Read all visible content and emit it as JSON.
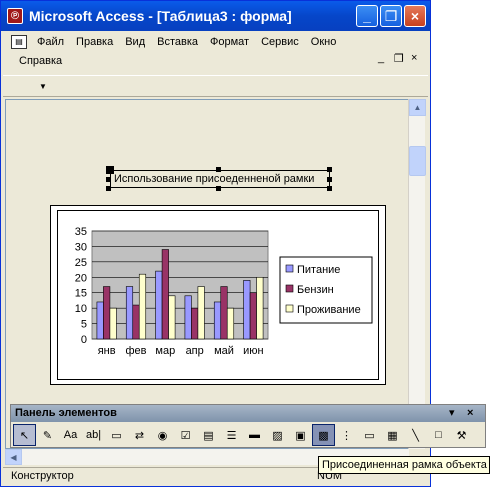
{
  "window": {
    "title": "Microsoft Access - [Таблица3 : форма]",
    "app_icon_glyph": "℗",
    "minimize_glyph": "_",
    "restore_glyph": "❐",
    "close_glyph": "×"
  },
  "menubar": {
    "row1": [
      "Файл",
      "Правка",
      "Вид",
      "Вставка",
      "Формат",
      "Сервис",
      "Окно"
    ],
    "row2": [
      "Справка"
    ],
    "mdi_min": "_",
    "mdi_restore": "❐",
    "mdi_close": "×"
  },
  "form": {
    "label_text": "Использование присоеденненой рамки"
  },
  "chart_data": {
    "type": "bar",
    "categories": [
      "янв",
      "фев",
      "мар",
      "апр",
      "май",
      "июн"
    ],
    "series": [
      {
        "name": "Питание",
        "values": [
          12,
          17,
          22,
          14,
          12,
          19
        ],
        "color": "#9999ff"
      },
      {
        "name": "Бензин",
        "values": [
          17,
          11,
          29,
          10,
          17,
          15
        ],
        "color": "#993366"
      },
      {
        "name": "Проживание",
        "values": [
          10,
          21,
          14,
          17,
          10,
          20
        ],
        "color": "#ffffcc"
      }
    ],
    "yticks": [
      "0",
      "5",
      "10",
      "15",
      "20",
      "25",
      "30",
      "35"
    ],
    "ylim": [
      0,
      35
    ],
    "plot_bg": "#c0c0c0",
    "grid": true,
    "legend": "right"
  },
  "palette": {
    "title": "Панель элементов",
    "title_menu": "▾",
    "title_close": "×",
    "tools": [
      {
        "name": "select-objects-tool",
        "glyph": "↖"
      },
      {
        "name": "control-wizards-tool",
        "glyph": "✎"
      },
      {
        "name": "label-tool",
        "glyph": "Aa"
      },
      {
        "name": "text-box-tool",
        "glyph": "ab|"
      },
      {
        "name": "option-group-tool",
        "glyph": "▭"
      },
      {
        "name": "toggle-button-tool",
        "glyph": "⇄"
      },
      {
        "name": "option-button-tool",
        "glyph": "◉"
      },
      {
        "name": "check-box-tool",
        "glyph": "☑"
      },
      {
        "name": "combo-box-tool",
        "glyph": "▤"
      },
      {
        "name": "list-box-tool",
        "glyph": "☰"
      },
      {
        "name": "command-button-tool",
        "glyph": "▬"
      },
      {
        "name": "image-tool",
        "glyph": "▨"
      },
      {
        "name": "unbound-object-frame-tool",
        "glyph": "▣"
      },
      {
        "name": "bound-object-frame-tool",
        "glyph": "▩"
      },
      {
        "name": "page-break-tool",
        "glyph": "⋮"
      },
      {
        "name": "tab-control-tool",
        "glyph": "▭"
      },
      {
        "name": "subform-tool",
        "glyph": "▦"
      },
      {
        "name": "line-tool",
        "glyph": "╲"
      },
      {
        "name": "rectangle-tool",
        "glyph": "□"
      },
      {
        "name": "more-controls-tool",
        "glyph": "⚒"
      }
    ]
  },
  "statusbar": {
    "mode": "Конструктор",
    "num": "NUM"
  },
  "tooltip": {
    "text": "Присоединенная рамка объекта"
  }
}
